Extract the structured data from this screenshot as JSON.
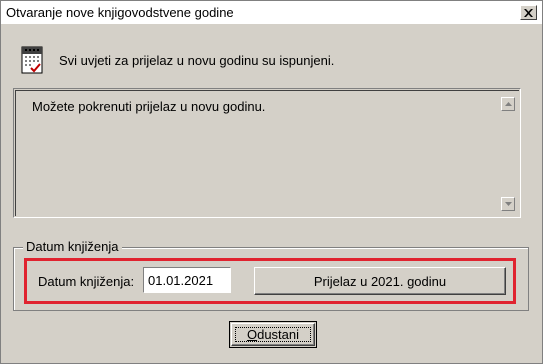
{
  "window": {
    "title": "Otvaranje nove knjigovodstvene godine",
    "close_symbol": "x"
  },
  "info": {
    "icon": "calendar-check-icon",
    "message": "Svi uvjeti za prijelaz u novu godinu su ispunjeni."
  },
  "memo": {
    "text": "Možete pokrenuti prijelaz u novu godinu."
  },
  "group": {
    "title": "Datum knjiženja",
    "date_label": "Datum knjiženja:",
    "date_value": "01.01.2021",
    "transition_button": "Prijelaz u 2021. godinu",
    "highlight_color": "#e0232f"
  },
  "footer": {
    "cancel_underlined": "O",
    "cancel_rest": "dustani"
  }
}
